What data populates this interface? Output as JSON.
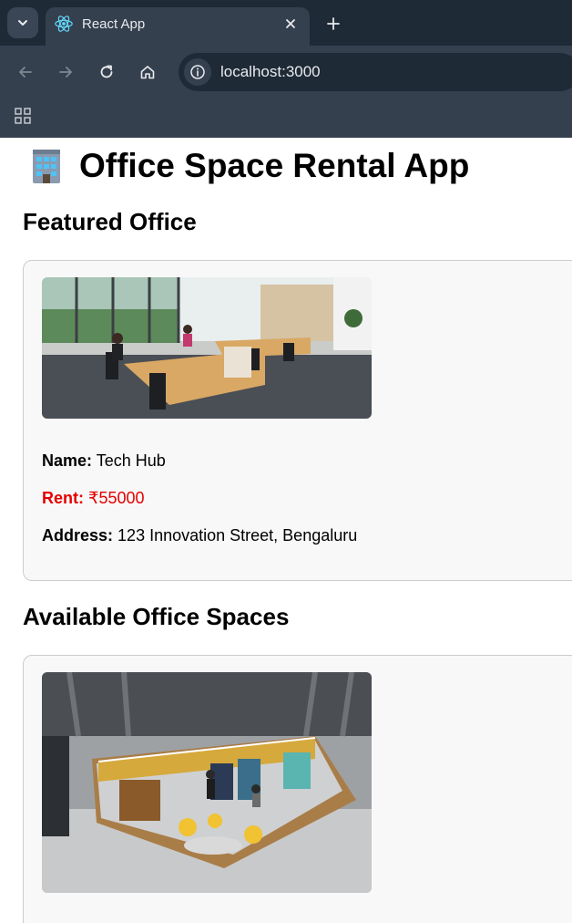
{
  "browser": {
    "tab_title": "React App",
    "url": "localhost:3000"
  },
  "app": {
    "title": "Office Space Rental App"
  },
  "featured": {
    "heading": "Featured Office",
    "name_label": "Name:",
    "name": "Tech Hub",
    "rent_label": "Rent:",
    "rent": "₹55000",
    "address_label": "Address:",
    "address": "123 Innovation Street, Bengaluru"
  },
  "available": {
    "heading": "Available Office Spaces"
  },
  "colors": {
    "rent_text": "#e60000",
    "card_background": "#f8f8f8",
    "chrome_background": "#35404f"
  }
}
